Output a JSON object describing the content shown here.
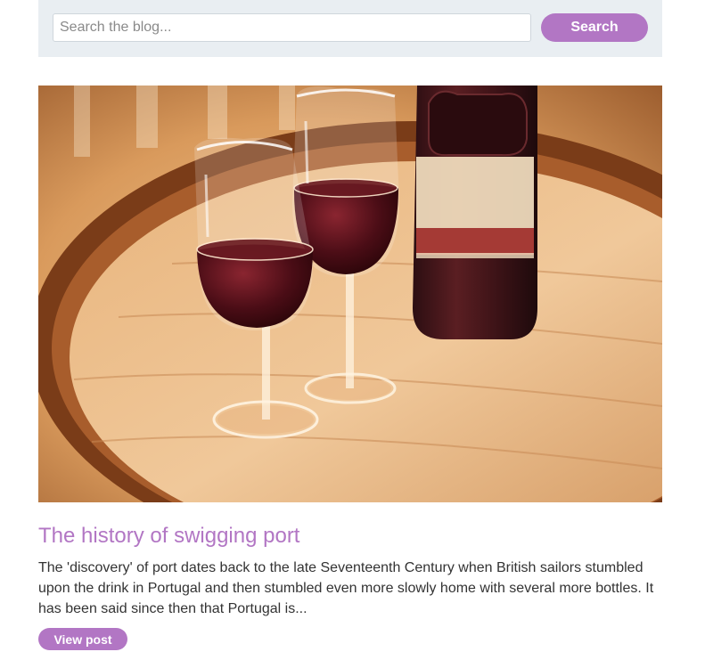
{
  "search": {
    "placeholder": "Search the blog...",
    "button_label": "Search"
  },
  "post": {
    "image_subject": "port-wine-glasses-and-bottle-on-barrel",
    "title": "The history of swigging port",
    "excerpt": "The 'discovery' of port dates back to the late Seventeenth Century when British sailors stumbled upon the drink in Portugal and then stumbled even more slowly home with several more bottles. It has been said since then that Portugal is...",
    "view_label": "View post"
  },
  "colors": {
    "accent": "#b276c4",
    "search_bg": "#e9eef2",
    "text": "#333333"
  }
}
